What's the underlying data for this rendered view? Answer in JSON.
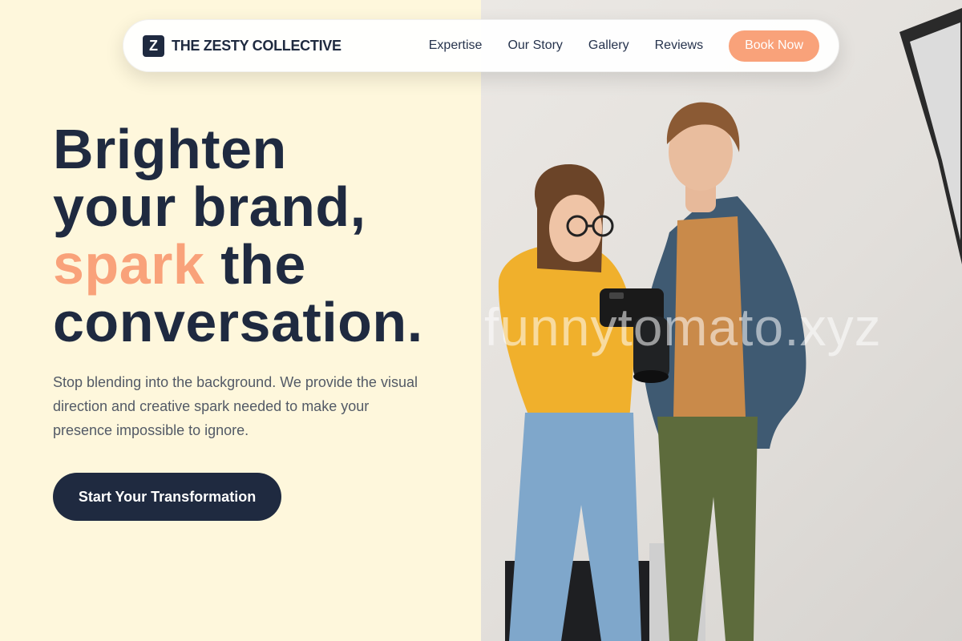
{
  "brand": {
    "logo_mark": "Z",
    "name": "THE ZESTY COLLECTIVE"
  },
  "nav": {
    "links": [
      "Expertise",
      "Our Story",
      "Gallery",
      "Reviews"
    ],
    "cta": "Book Now"
  },
  "hero": {
    "line1": "Brighten",
    "line2": "your brand,",
    "accent_word": "spark",
    "line3_rest": " the",
    "line4": "conversation.",
    "description": "Stop blending into the background. We provide the visual direction and creative spark needed to make your presence impossible to ignore.",
    "button": "Start Your Transformation"
  },
  "photo": {
    "watermark": "funnytomato.xyz",
    "subject": "photographer-couple-with-camera"
  },
  "colors": {
    "accent": "#f9a27a",
    "navy": "#1f2a40",
    "cream": "#fef7dc"
  }
}
